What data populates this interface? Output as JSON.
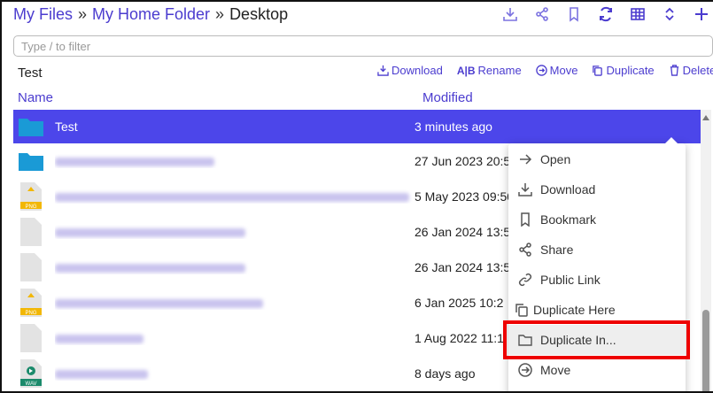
{
  "breadcrumb": {
    "root": "My Files",
    "sep": "»",
    "home": "My Home Folder",
    "current": "Desktop"
  },
  "filter": {
    "placeholder": "Type / to filter"
  },
  "selection": {
    "title": "Test"
  },
  "actions": {
    "download": "Download",
    "rename": "Rename",
    "rename_prefix": "A|B",
    "move": "Move",
    "duplicate": "Duplicate",
    "delete": "Delete"
  },
  "columns": {
    "name": "Name",
    "modified": "Modified"
  },
  "rows": [
    {
      "name": "Test",
      "modified": "3 minutes ago",
      "icon": "folder-icon",
      "selected": true
    },
    {
      "name": "",
      "modified": "27 Jun 2023 20:5",
      "icon": "folder-icon"
    },
    {
      "name": "",
      "modified": "5 May 2023 09:50",
      "icon": "png-file-icon",
      "badge": "PNG"
    },
    {
      "name": "",
      "modified": "26 Jan 2024 13:5",
      "icon": "file-icon"
    },
    {
      "name": "",
      "modified": "26 Jan 2024 13:5",
      "icon": "file-icon"
    },
    {
      "name": "",
      "modified": "6 Jan 2025 10:2",
      "icon": "png-file-icon",
      "badge": "PNG"
    },
    {
      "name": "",
      "modified": "1 Aug 2022 11:1",
      "icon": "file-icon"
    },
    {
      "name": "",
      "modified": "8 days ago",
      "icon": "wav-file-icon",
      "badge": "WAV"
    }
  ],
  "menu": {
    "open": "Open",
    "download": "Download",
    "bookmark": "Bookmark",
    "share": "Share",
    "public_link": "Public Link",
    "duplicate_here": "Duplicate Here",
    "duplicate_in": "Duplicate In...",
    "move": "Move"
  },
  "colors": {
    "accent": "#4b3ccf",
    "selected_row": "#4c46ea",
    "folder": "#1a9ad6",
    "highlight_box": "#e00000"
  }
}
